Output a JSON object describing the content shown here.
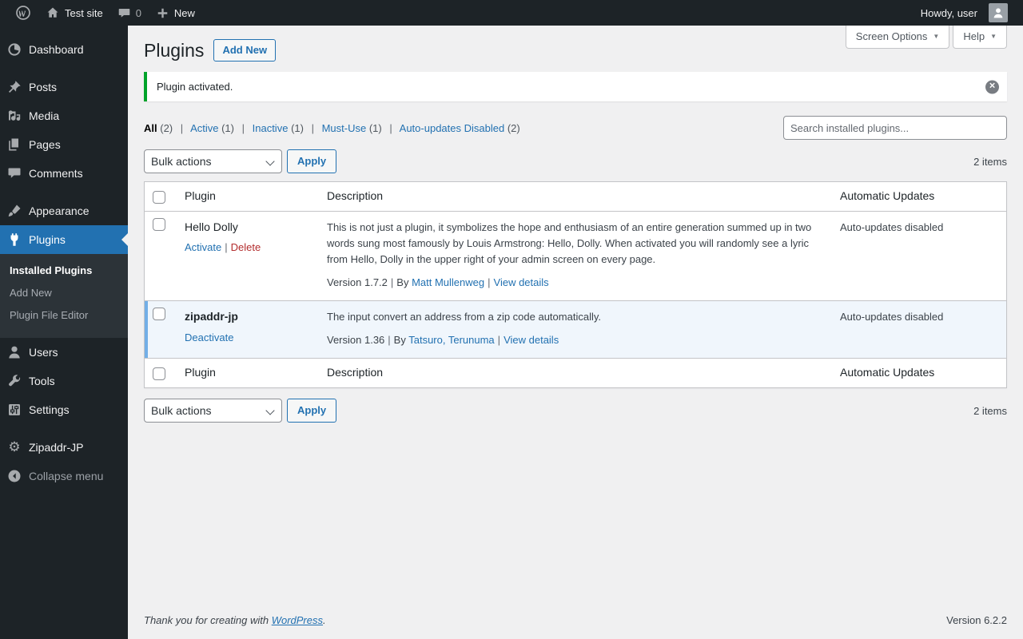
{
  "admin_bar": {
    "site_name": "Test site",
    "comment_count": "0",
    "new_label": "New",
    "howdy": "Howdy, user"
  },
  "icons": {
    "wp_logo_letter": "W",
    "chevron_down": "▼",
    "dismiss": "✕",
    "gear": "⚙"
  },
  "sidebar": {
    "dashboard": "Dashboard",
    "posts": "Posts",
    "media": "Media",
    "pages": "Pages",
    "comments": "Comments",
    "appearance": "Appearance",
    "plugins": "Plugins",
    "submenu": {
      "installed_plugins": "Installed Plugins",
      "add_new": "Add New",
      "plugin_file_editor": "Plugin File Editor"
    },
    "users": "Users",
    "tools": "Tools",
    "settings": "Settings",
    "zipaddr": "Zipaddr-JP",
    "collapse_menu": "Collapse menu"
  },
  "header": {
    "title": "Plugins",
    "add_new": "Add New",
    "screen_options": "Screen Options",
    "help": "Help"
  },
  "notice": {
    "message": "Plugin activated."
  },
  "filters": {
    "sep": "|",
    "all": "All",
    "all_count": "(2)",
    "active": "Active",
    "active_count": "(1)",
    "inactive": "Inactive",
    "inactive_count": "(1)",
    "must_use": "Must-Use",
    "must_use_count": "(1)",
    "auto_disabled": "Auto-updates Disabled",
    "auto_disabled_count": "(2)"
  },
  "search": {
    "placeholder": "Search installed plugins..."
  },
  "tablenav": {
    "bulk_actions": "Bulk actions",
    "apply": "Apply",
    "items": "2 items"
  },
  "table": {
    "sep": "|",
    "headers": {
      "plugin": "Plugin",
      "description": "Description",
      "auto_updates": "Automatic Updates"
    },
    "rows": [
      {
        "name": "Hello Dolly",
        "activate": "Activate",
        "delete": "Delete",
        "description": "This is not just a plugin, it symbolizes the hope and enthusiasm of an entire generation summed up in two words sung most famously by Louis Armstrong: Hello, Dolly. When activated you will randomly see a lyric from Hello, Dolly in the upper right of your admin screen on every page.",
        "version": "Version 1.7.2",
        "by": "By",
        "author": "Matt Mullenweg",
        "view_details": "View details",
        "auto_update": "Auto-updates disabled"
      },
      {
        "name": "zipaddr-jp",
        "deactivate": "Deactivate",
        "description": "The input convert an address from a zip code automatically.",
        "version": "Version 1.36",
        "by": "By",
        "author": "Tatsuro, Terunuma",
        "view_details": "View details",
        "auto_update": "Auto-updates disabled"
      }
    ]
  },
  "footer": {
    "thanks": "Thank you for creating with",
    "wordpress": "WordPress",
    "period": ".",
    "version": "Version 6.2.2"
  },
  "colors": {
    "accent_blue": "#2271b1",
    "success_green": "#00a32a",
    "delete_red": "#b32d2e",
    "active_row_bg": "#f0f6fc",
    "active_row_border": "#72aee6",
    "admin_dark": "#1d2327"
  }
}
